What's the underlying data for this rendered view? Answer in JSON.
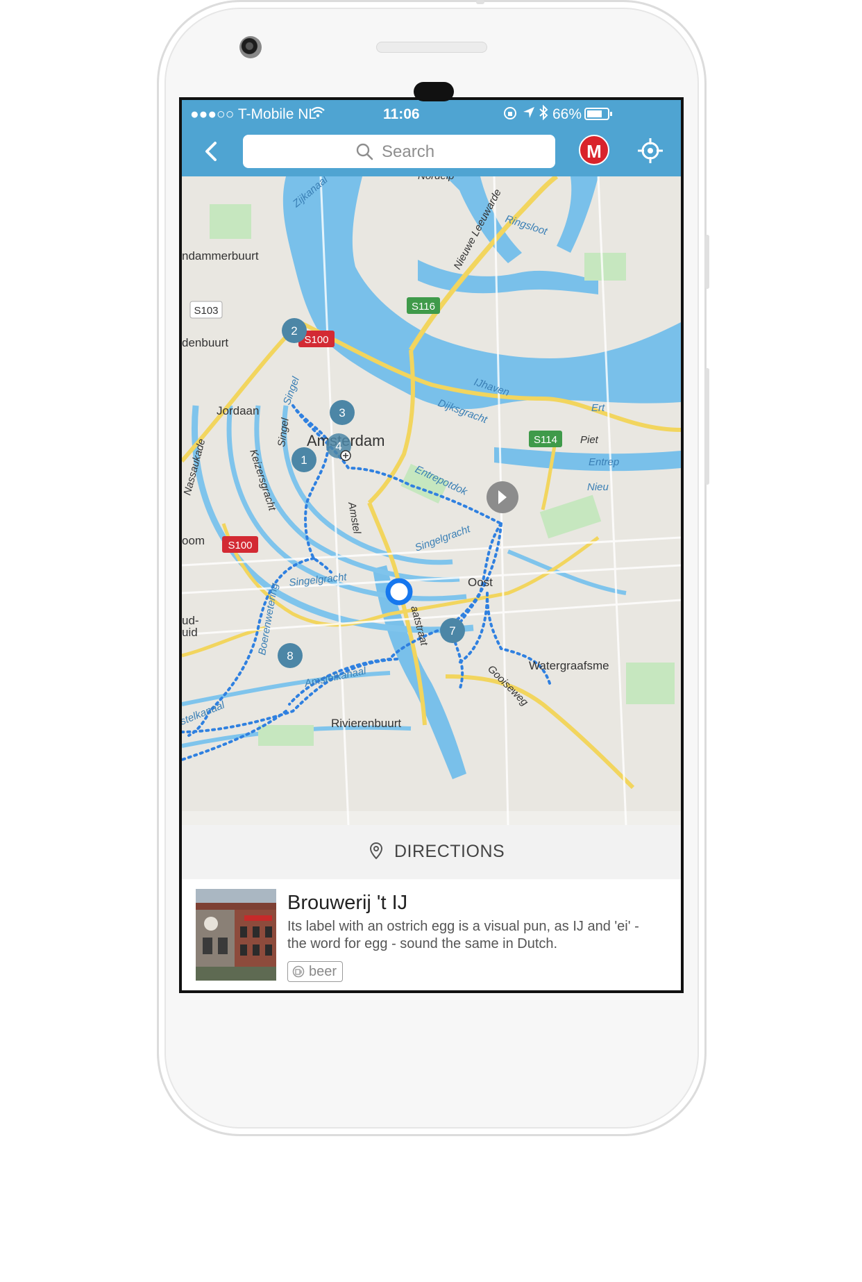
{
  "status": {
    "carrier": "●●●○○ T-Mobile NL",
    "time": "11:06",
    "battery": "66%"
  },
  "nav": {
    "search_placeholder": "Search",
    "badge_letter": "M",
    "accent_color": "#4fa4d2"
  },
  "map": {
    "districts": [
      "ndammerbuurt",
      "denbuurt",
      "Jordaan",
      "Amsterdam",
      "Oost",
      "Watergraafsme",
      "Rivierenbuurt",
      "uid",
      "ud-",
      "oom"
    ],
    "streets": [
      "Zijkanaal",
      "Nieuwe Leeuwarde",
      "Ringsloot",
      "IJhaven",
      "Dijksgracht",
      "Entrepotdok",
      "Singel",
      "Singel",
      "Keizersgracht",
      "Nassaukade",
      "Amstel",
      "Singelgracht",
      "Singelgracht",
      "Boerenwetering",
      "Amstelkanaal",
      "stelkanaal",
      "Gooiseweg",
      "aatstraat",
      "Piet",
      "Entrep",
      "Nieu",
      "Ert",
      "Nordelp"
    ],
    "route_shields": {
      "s103": "S103",
      "s100a": "S100",
      "s100b": "S100",
      "s116": "S116",
      "s114": "S114"
    },
    "stops": [
      "2",
      "3",
      "4",
      "1",
      "7",
      "8"
    ],
    "route_color": "#2f80e0",
    "stop_color": "#4c86a6"
  },
  "directions": {
    "label": "DIRECTIONS"
  },
  "place": {
    "name": "Brouwerij 't IJ",
    "description": "Its label with an ostrich egg is a visual pun, as IJ and 'ei' - the word for egg - sound the same in Dutch.",
    "tag": "beer"
  }
}
